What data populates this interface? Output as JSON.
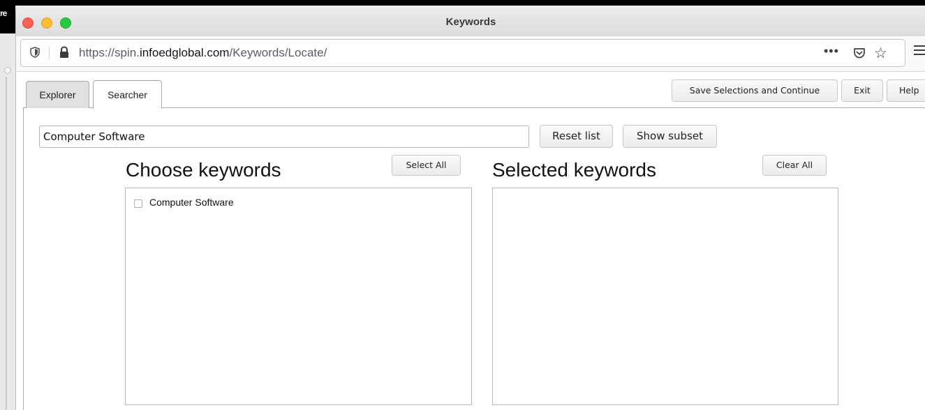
{
  "desktop": {
    "corner_text": "re"
  },
  "window": {
    "title": "Keywords"
  },
  "urlbar": {
    "url_prefix": "https://spin.",
    "url_domain": "infoedglobal.com",
    "url_path": "/Keywords/Locate/",
    "more_glyph": "•••",
    "star_glyph": "☆"
  },
  "tabs": [
    {
      "label": "Explorer",
      "active": false
    },
    {
      "label": "Searcher",
      "active": true
    }
  ],
  "toolbar": {
    "save_label": "Save Selections and Continue",
    "exit_label": "Exit",
    "help_label": "Help"
  },
  "search": {
    "value": "Computer Software",
    "reset_label": "Reset list",
    "subset_label": "Show subset"
  },
  "choose": {
    "title": "Choose keywords",
    "select_all_label": "Select All",
    "items": [
      {
        "label": "Computer Software",
        "checked": false
      }
    ]
  },
  "selected": {
    "title": "Selected keywords",
    "clear_all_label": "Clear All",
    "items": []
  },
  "colors": {
    "traffic_red": "#fe5f57",
    "traffic_yellow": "#febc2e",
    "traffic_green": "#28c840"
  }
}
